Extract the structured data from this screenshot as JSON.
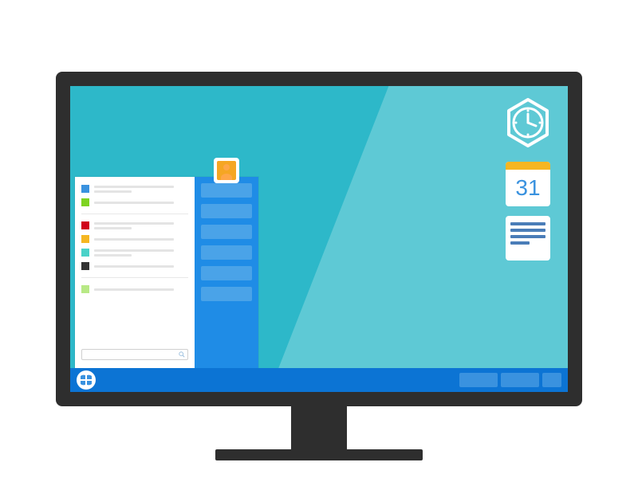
{
  "calendar": {
    "day": "31"
  },
  "start_menu": {
    "items": [
      {
        "icon_color": "icon-blue"
      },
      {
        "icon_color": "icon-green"
      },
      {
        "icon_color": "icon-red"
      },
      {
        "icon_color": "icon-yellow"
      },
      {
        "icon_color": "icon-cyan"
      },
      {
        "icon_color": "icon-black"
      },
      {
        "icon_color": "icon-lime"
      }
    ]
  },
  "colors": {
    "desktop_bg": "#2db8c9",
    "desktop_gloss": "#5ec9d5",
    "taskbar": "#0c74d4",
    "accent": "#1f8ce6",
    "calendar_header": "#f5b622"
  }
}
